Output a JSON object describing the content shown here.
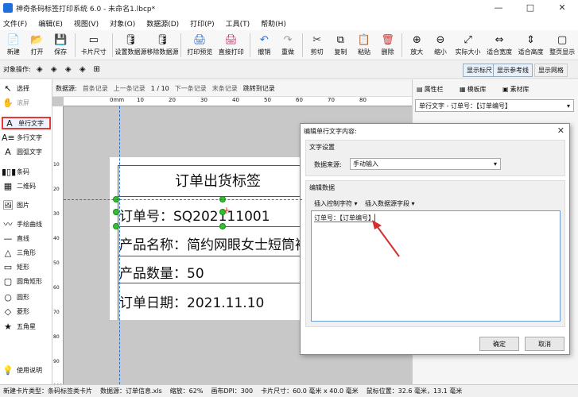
{
  "window": {
    "title": "神奇条码标签打印系统 6.0 - 未命名1.lbcp*",
    "controls": [
      "—",
      "□",
      "✕"
    ]
  },
  "menu": [
    "文件(F)",
    "编辑(E)",
    "视图(V)",
    "对象(O)",
    "数据源(D)",
    "打印(P)",
    "工具(T)",
    "帮助(H)"
  ],
  "toolbar": [
    {
      "label": "新建",
      "icon": "new-file-icon",
      "glyph": "📄"
    },
    {
      "label": "打开",
      "icon": "open-folder-icon",
      "glyph": "📂"
    },
    {
      "label": "保存",
      "icon": "save-icon",
      "glyph": "💾"
    },
    {
      "label": "卡片尺寸",
      "icon": "card-size-icon",
      "glyph": "▭"
    },
    {
      "label": "设置数据源",
      "icon": "database-icon",
      "glyph": "🛢"
    },
    {
      "label": "移除数据源",
      "icon": "remove-database-icon",
      "glyph": "🛢"
    },
    {
      "label": "打印预览",
      "icon": "print-preview-icon",
      "glyph": "🖨"
    },
    {
      "label": "直接打印",
      "icon": "print-icon",
      "glyph": "🖨"
    },
    {
      "label": "撤销",
      "icon": "undo-icon",
      "glyph": "↶"
    },
    {
      "label": "重做",
      "icon": "redo-icon",
      "glyph": "↷"
    },
    {
      "label": "剪切",
      "icon": "cut-icon",
      "glyph": "✂"
    },
    {
      "label": "复制",
      "icon": "copy-icon",
      "glyph": "⧉"
    },
    {
      "label": "粘贴",
      "icon": "paste-icon",
      "glyph": "📋"
    },
    {
      "label": "删除",
      "icon": "delete-icon",
      "glyph": "🗑"
    },
    {
      "label": "放大",
      "icon": "zoom-in-icon",
      "glyph": "⊕"
    },
    {
      "label": "缩小",
      "icon": "zoom-out-icon",
      "glyph": "⊖"
    },
    {
      "label": "实际大小",
      "icon": "actual-size-icon",
      "glyph": "⤢"
    },
    {
      "label": "适合宽度",
      "icon": "fit-width-icon",
      "glyph": "⇔"
    },
    {
      "label": "适合高度",
      "icon": "fit-height-icon",
      "glyph": "⇕"
    },
    {
      "label": "整页显示",
      "icon": "full-page-icon",
      "glyph": "▢"
    }
  ],
  "opsbar": {
    "label": "对象操作:",
    "toggles": [
      "显示标尺",
      "显示参考线",
      "显示网格"
    ]
  },
  "tools": [
    {
      "label": "选择",
      "icon": "cursor-icon",
      "glyph": "↖"
    },
    {
      "label": "滚屏",
      "icon": "hand-icon",
      "glyph": "✋"
    },
    {
      "label": "单行文字",
      "icon": "single-line-text-icon",
      "glyph": "A"
    },
    {
      "label": "多行文字",
      "icon": "multi-line-text-icon",
      "glyph": "A≡"
    },
    {
      "label": "圆弧文字",
      "icon": "arc-text-icon",
      "glyph": "A"
    },
    {
      "label": "条码",
      "icon": "barcode-icon",
      "glyph": "▮▯▮"
    },
    {
      "label": "二维码",
      "icon": "qrcode-icon",
      "glyph": "▦"
    },
    {
      "label": "图片",
      "icon": "image-icon",
      "glyph": "🖼"
    },
    {
      "label": "手绘曲线",
      "icon": "freehand-icon",
      "glyph": "〰"
    },
    {
      "label": "直线",
      "icon": "line-icon",
      "glyph": "—"
    },
    {
      "label": "三角形",
      "icon": "triangle-icon",
      "glyph": "△"
    },
    {
      "label": "矩形",
      "icon": "rectangle-icon",
      "glyph": "▭"
    },
    {
      "label": "圆角矩形",
      "icon": "rounded-rectangle-icon",
      "glyph": "▢"
    },
    {
      "label": "圆形",
      "icon": "circle-icon",
      "glyph": "○"
    },
    {
      "label": "菱形",
      "icon": "diamond-icon",
      "glyph": "◇"
    },
    {
      "label": "五角星",
      "icon": "star-icon",
      "glyph": "★"
    },
    {
      "label": "使用说明",
      "icon": "lightbulb-icon",
      "glyph": "💡"
    }
  ],
  "databar": {
    "label": "数据源:",
    "first": "首条记录",
    "prev": "上一条记录",
    "page": "1 / 10",
    "next": "下一条记录",
    "last": "末条记录",
    "jump": "跳转到记录"
  },
  "ruler": {
    "h_unit": "0mm",
    "h_ticks": [
      "10",
      "20",
      "30",
      "40",
      "50",
      "60",
      "70",
      "80"
    ],
    "v_ticks": [
      "10",
      "20",
      "30",
      "40",
      "50",
      "60",
      "70",
      "80",
      "90",
      "100"
    ]
  },
  "label": {
    "title": "订单出货标签",
    "line1": "订单号：SQ202111001",
    "line2": "产品名称：简约网眼女士短筒袜",
    "line3": "产品数量：50",
    "line4": "订单日期：2021.11.10"
  },
  "rightpanel": {
    "tabs": [
      "属性栏",
      "模板库",
      "素材库"
    ],
    "selected_object": "单行文字 - 订单号：【订单编号】"
  },
  "dialog": {
    "title": "编辑单行文字内容:",
    "close": "✕",
    "section_settings": "文字设置",
    "source_label": "数据来源:",
    "source_value": "手动输入",
    "section_edit": "编辑数据",
    "insert_control": "插入控制字符",
    "insert_field": "插入数据源字段",
    "content": "订单号：【订单编号】",
    "ok": "确定",
    "cancel": "取消"
  },
  "status": {
    "card_type": "新建卡片类型：条码标签类卡片",
    "datasource": "数据源：订单信息.xls",
    "zoom": "缩放：62%",
    "dpi": "画布DPI：300",
    "card_size": "卡片尺寸：60.0 毫米 x 40.0 毫米",
    "cursor": "鼠标位置：32.6 毫米，13.1 毫米"
  },
  "colors": {
    "accent": "#1e6fd9",
    "handle": "#2ec22e",
    "highlight": "#e53935",
    "arrow": "#d32f2f"
  }
}
